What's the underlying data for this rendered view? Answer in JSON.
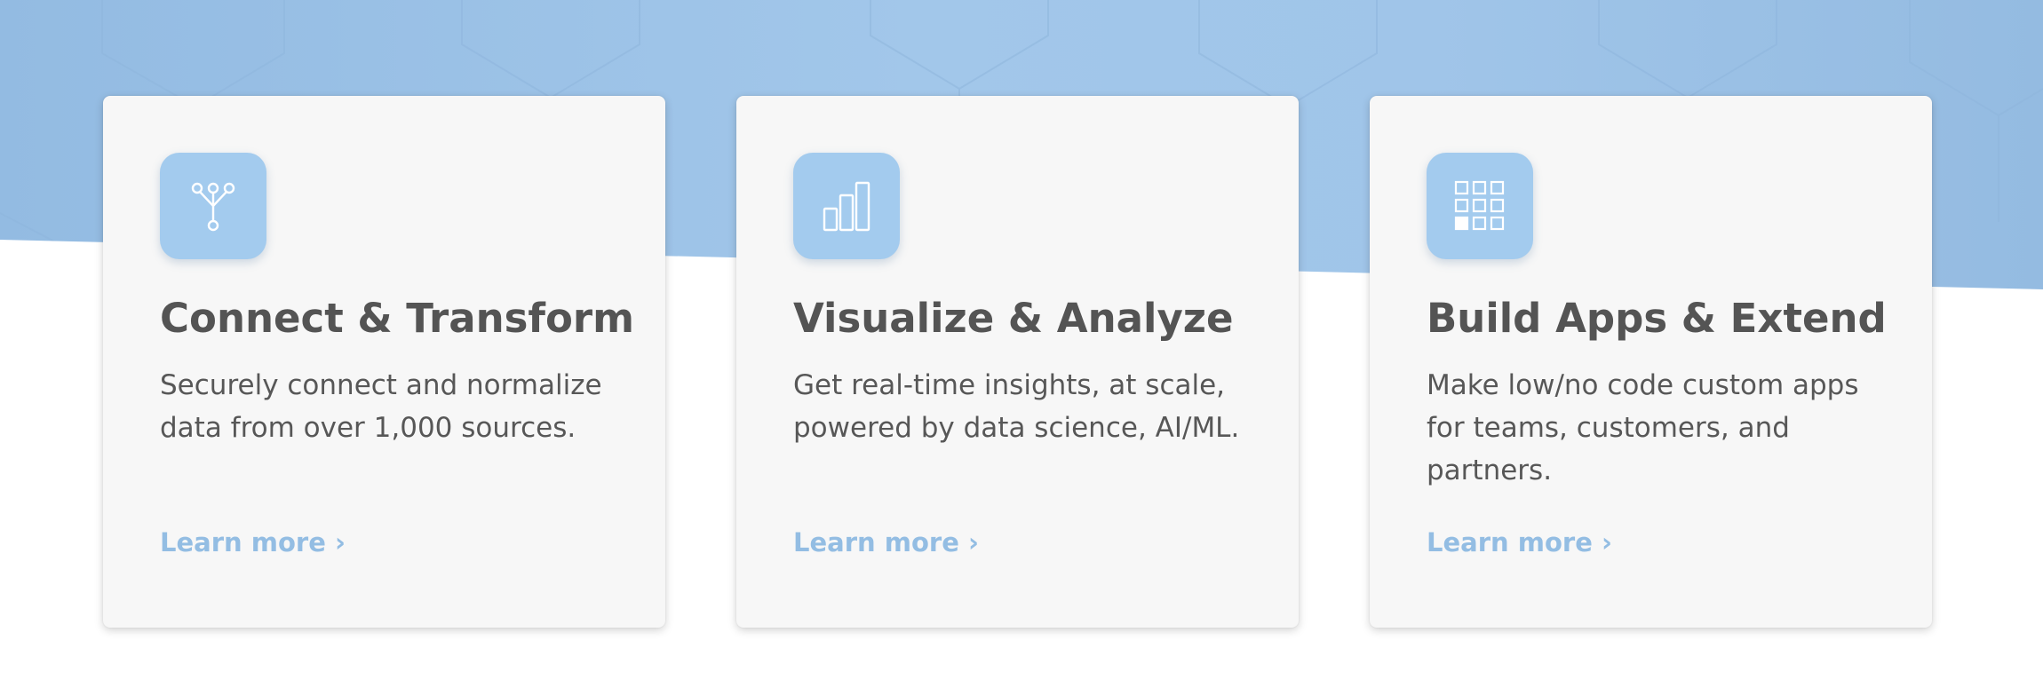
{
  "theme": {
    "accent": "#93bde3",
    "band_color": "#a0c5e9",
    "card_background": "#f7f7f7",
    "text_color": "#545454"
  },
  "cards": [
    {
      "icon": "data-flow-icon",
      "title": "Connect & Transform",
      "body": "Securely connect and normalize data from over 1,000 sources.",
      "link": "Learn more ›"
    },
    {
      "icon": "bar-chart-icon",
      "title": "Visualize & Analyze",
      "body": "Get real-time insights, at scale, powered by data science, AI/ML.",
      "link": "Learn more ›"
    },
    {
      "icon": "app-grid-icon",
      "title": "Build Apps & Extend",
      "body": "Make low/no code custom apps for teams, customers, and partners.",
      "link": "Learn more ›"
    }
  ]
}
